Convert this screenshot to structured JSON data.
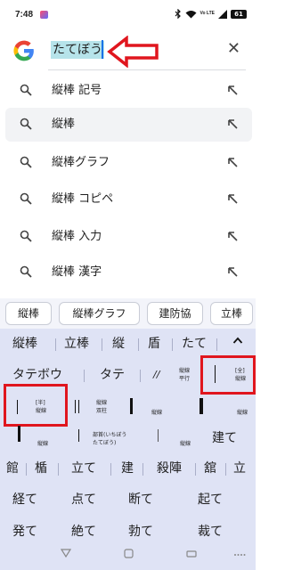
{
  "status": {
    "time": "7:48",
    "volte": "Vo LTE",
    "battery": "61"
  },
  "search": {
    "query": "たてぼう"
  },
  "suggestions": [
    {
      "text": "縦棒 記号"
    },
    {
      "text": "縦棒"
    },
    {
      "text": "縦棒グラフ"
    },
    {
      "text": "縦棒 コピペ"
    },
    {
      "text": "縦棒 入力"
    },
    {
      "text": "縦棒 漢字"
    }
  ],
  "chips": [
    "縦棒",
    "縦棒グラフ",
    "建防協",
    "立棒"
  ],
  "keyboard": {
    "row1": [
      "縦棒",
      "立棒",
      "縦",
      "盾",
      "たて"
    ],
    "row2": {
      "tatebou": "タテボウ",
      "tate": "タテ",
      "slashes": "//",
      "heikou_a": "縦線",
      "heikou_b": "平行",
      "zen_a": "[全]",
      "zen_b": "縦線"
    },
    "row3": {
      "han_a": "[半]",
      "han_b": "縦線",
      "nijuu_a": "縦線",
      "nijuu_b": "双柱",
      "small_a": "縦線",
      "small_b": "縦線"
    },
    "row4": {
      "a": "縦線",
      "bushu_a": "部首(いちぼう",
      "bushu_b": "たてぼう)",
      "b": "縦線",
      "tate": "建て"
    },
    "row5": [
      "館",
      "楯",
      "立て",
      "建",
      "殺陣",
      "舘",
      "立"
    ],
    "row6": [
      "経て",
      "点て",
      "断て",
      "起て"
    ],
    "row7": [
      "発て",
      "絶て",
      "勃て",
      "裁て"
    ]
  }
}
